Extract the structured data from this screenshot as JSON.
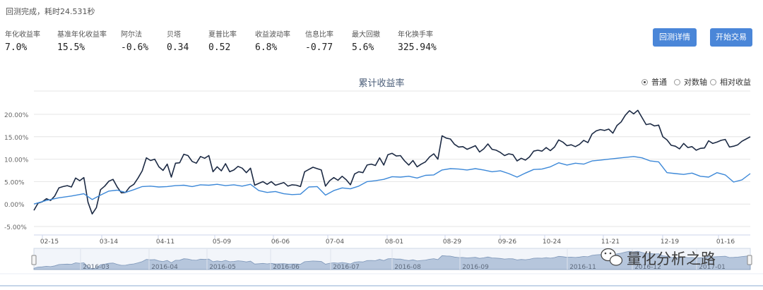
{
  "status": {
    "text": "回测完成，耗时24.531秒"
  },
  "metrics": [
    {
      "label": "年化收益率",
      "value": "7.0%"
    },
    {
      "label": "基准年化收益率",
      "value": "15.5%"
    },
    {
      "label": "阿尔法",
      "value": "-0.6%"
    },
    {
      "label": "贝塔",
      "value": "0.34"
    },
    {
      "label": "夏普比率",
      "value": "0.52"
    },
    {
      "label": "收益波动率",
      "value": "6.8%"
    },
    {
      "label": "信息比率",
      "value": "-0.77"
    },
    {
      "label": "最大回撤",
      "value": "5.6%"
    },
    {
      "label": "年化换手率",
      "value": "325.94%"
    }
  ],
  "buttons": {
    "details": "回测详情",
    "trade": "开始交易"
  },
  "chart_options": [
    {
      "label": "普通",
      "selected": true
    },
    {
      "label": "对数轴",
      "selected": false
    },
    {
      "label": "相对收益",
      "selected": false
    }
  ],
  "watermark": {
    "text": "量化分析之路"
  },
  "chart_data": {
    "type": "line",
    "title": "累计收益率",
    "y_ticks": [
      "20.00%",
      "15.00%",
      "10.00%",
      "5.00%",
      "0.00%",
      "-5.00%"
    ],
    "ylim": [
      -5,
      20
    ],
    "x_tick_labels": [
      "02-15",
      "03-14",
      "04-11",
      "05-09",
      "06-06",
      "07-04",
      "08-01",
      "08-29",
      "09-26",
      "10-24",
      "11-21",
      "12-19",
      "01-16"
    ],
    "navigator_labels": [
      "2016-03",
      "2016-04",
      "2016-05",
      "2016-06",
      "2016-07",
      "2016-08",
      "2016-09",
      "2016-11",
      "2016-12",
      "2017-01"
    ],
    "grid": true,
    "legend": "none",
    "colors": {
      "benchmark": "#1c2a44",
      "strategy": "#3c88d8"
    },
    "series": [
      {
        "key": "benchmark",
        "points": [
          [
            0,
            -1.4
          ],
          [
            1,
            0.2
          ],
          [
            2,
            0.5
          ],
          [
            3,
            1.2
          ],
          [
            4,
            0.8
          ],
          [
            5,
            1.8
          ],
          [
            6,
            3.6
          ],
          [
            7,
            3.9
          ],
          [
            8,
            4.1
          ],
          [
            9,
            3.8
          ],
          [
            10,
            5.8
          ],
          [
            11,
            5.2
          ],
          [
            12,
            5.9
          ],
          [
            13,
            0.4
          ],
          [
            14,
            -2.2
          ],
          [
            15,
            -0.8
          ],
          [
            16,
            3.2
          ],
          [
            17,
            4.0
          ],
          [
            18,
            5.1
          ],
          [
            19,
            5.5
          ],
          [
            20,
            3.8
          ],
          [
            21,
            2.5
          ],
          [
            22,
            2.6
          ],
          [
            23,
            3.8
          ],
          [
            24,
            4.4
          ],
          [
            25,
            5.8
          ],
          [
            26,
            7.4
          ],
          [
            27,
            10.3
          ],
          [
            28,
            9.7
          ],
          [
            29,
            10.0
          ],
          [
            30,
            8.3
          ],
          [
            31,
            7.5
          ],
          [
            32,
            8.9
          ],
          [
            33,
            6.0
          ],
          [
            34,
            9.1
          ],
          [
            35,
            9.2
          ],
          [
            36,
            11.1
          ],
          [
            37,
            10.8
          ],
          [
            38,
            9.5
          ],
          [
            39,
            9.1
          ],
          [
            40,
            10.6
          ],
          [
            41,
            10.2
          ],
          [
            42,
            10.8
          ],
          [
            43,
            7.2
          ],
          [
            44,
            8.3
          ],
          [
            45,
            7.4
          ],
          [
            46,
            9.0
          ],
          [
            47,
            7.2
          ],
          [
            48,
            7.6
          ],
          [
            49,
            8.4
          ],
          [
            50,
            8.0
          ],
          [
            51,
            7.0
          ],
          [
            52,
            8.0
          ],
          [
            53,
            4.2
          ],
          [
            54,
            4.6
          ],
          [
            55,
            5.0
          ],
          [
            56,
            4.4
          ],
          [
            57,
            5.0
          ],
          [
            58,
            4.2
          ],
          [
            59,
            4.5
          ],
          [
            60,
            4.8
          ],
          [
            61,
            4.0
          ],
          [
            62,
            4.3
          ],
          [
            63,
            4.2
          ],
          [
            64,
            3.9
          ],
          [
            65,
            7.2
          ],
          [
            66,
            7.7
          ],
          [
            67,
            8.2
          ],
          [
            68,
            7.9
          ],
          [
            69,
            7.6
          ],
          [
            70,
            4.0
          ],
          [
            71,
            5.2
          ],
          [
            72,
            5.9
          ],
          [
            73,
            5.3
          ],
          [
            74,
            6.2
          ],
          [
            75,
            5.4
          ],
          [
            76,
            4.3
          ],
          [
            77,
            6.7
          ],
          [
            78,
            7.2
          ],
          [
            79,
            7.0
          ],
          [
            80,
            8.7
          ],
          [
            81,
            8.9
          ],
          [
            82,
            8.6
          ],
          [
            83,
            10.3
          ],
          [
            84,
            8.7
          ],
          [
            85,
            11.0
          ],
          [
            86,
            11.3
          ],
          [
            87,
            10.7
          ],
          [
            88,
            10.8
          ],
          [
            89,
            9.6
          ],
          [
            90,
            8.7
          ],
          [
            91,
            9.7
          ],
          [
            92,
            8.3
          ],
          [
            93,
            8.9
          ],
          [
            94,
            9.4
          ],
          [
            95,
            10.5
          ],
          [
            96,
            11.2
          ],
          [
            97,
            10.0
          ],
          [
            98,
            15.2
          ],
          [
            99,
            14.7
          ],
          [
            100,
            14.5
          ],
          [
            101,
            13.3
          ],
          [
            102,
            12.7
          ],
          [
            103,
            12.8
          ],
          [
            104,
            12.2
          ],
          [
            105,
            12.6
          ],
          [
            106,
            13.0
          ],
          [
            107,
            11.6
          ],
          [
            108,
            12.3
          ],
          [
            109,
            13.4
          ],
          [
            110,
            12.2
          ],
          [
            111,
            12.0
          ],
          [
            112,
            11.5
          ],
          [
            113,
            10.8
          ],
          [
            114,
            11.2
          ],
          [
            115,
            11.0
          ],
          [
            116,
            9.6
          ],
          [
            117,
            10.2
          ],
          [
            118,
            9.8
          ],
          [
            119,
            10.5
          ],
          [
            120,
            11.8
          ],
          [
            121,
            12.0
          ],
          [
            122,
            11.8
          ],
          [
            123,
            12.6
          ],
          [
            124,
            11.9
          ],
          [
            125,
            12.7
          ],
          [
            126,
            14.3
          ],
          [
            127,
            13.8
          ],
          [
            128,
            13.0
          ],
          [
            129,
            13.2
          ],
          [
            130,
            12.8
          ],
          [
            131,
            13.3
          ],
          [
            132,
            14.2
          ],
          [
            133,
            13.7
          ],
          [
            134,
            15.6
          ],
          [
            135,
            16.3
          ],
          [
            136,
            16.6
          ],
          [
            137,
            16.4
          ],
          [
            138,
            16.7
          ],
          [
            139,
            15.8
          ],
          [
            140,
            17.5
          ],
          [
            141,
            18.3
          ],
          [
            142,
            19.8
          ],
          [
            143,
            20.8
          ],
          [
            144,
            20.1
          ],
          [
            145,
            20.9
          ],
          [
            146,
            19.3
          ],
          [
            147,
            17.7
          ],
          [
            148,
            17.9
          ],
          [
            149,
            17.4
          ],
          [
            150,
            17.6
          ],
          [
            151,
            15.0
          ],
          [
            152,
            14.3
          ],
          [
            153,
            13.1
          ],
          [
            154,
            12.9
          ],
          [
            155,
            12.3
          ],
          [
            156,
            13.5
          ],
          [
            157,
            12.6
          ],
          [
            158,
            12.8
          ],
          [
            159,
            12.0
          ],
          [
            160,
            12.4
          ],
          [
            161,
            12.5
          ],
          [
            162,
            14.1
          ],
          [
            163,
            13.5
          ],
          [
            164,
            13.8
          ],
          [
            165,
            14.2
          ],
          [
            166,
            14.4
          ],
          [
            167,
            12.7
          ],
          [
            168,
            12.9
          ],
          [
            169,
            13.2
          ],
          [
            170,
            14.0
          ],
          [
            171,
            14.5
          ],
          [
            172,
            15.0
          ]
        ]
      },
      {
        "key": "strategy",
        "points": [
          [
            0,
            0.0
          ],
          [
            3,
            0.8
          ],
          [
            6,
            1.4
          ],
          [
            9,
            1.8
          ],
          [
            12,
            2.3
          ],
          [
            14,
            1.0
          ],
          [
            16,
            2.0
          ],
          [
            18,
            2.9
          ],
          [
            20,
            3.1
          ],
          [
            22,
            2.6
          ],
          [
            24,
            3.2
          ],
          [
            26,
            3.9
          ],
          [
            28,
            4.0
          ],
          [
            30,
            3.8
          ],
          [
            32,
            3.9
          ],
          [
            34,
            4.1
          ],
          [
            36,
            4.2
          ],
          [
            38,
            3.9
          ],
          [
            40,
            4.3
          ],
          [
            42,
            4.2
          ],
          [
            44,
            4.4
          ],
          [
            46,
            4.1
          ],
          [
            48,
            4.3
          ],
          [
            50,
            4.0
          ],
          [
            52,
            4.4
          ],
          [
            54,
            3.0
          ],
          [
            56,
            2.6
          ],
          [
            58,
            2.8
          ],
          [
            60,
            2.3
          ],
          [
            62,
            2.1
          ],
          [
            64,
            2.2
          ],
          [
            66,
            3.8
          ],
          [
            68,
            3.9
          ],
          [
            70,
            2.0
          ],
          [
            72,
            3.0
          ],
          [
            74,
            3.6
          ],
          [
            76,
            3.4
          ],
          [
            78,
            4.0
          ],
          [
            80,
            5.0
          ],
          [
            82,
            5.2
          ],
          [
            84,
            5.5
          ],
          [
            86,
            6.1
          ],
          [
            88,
            6.0
          ],
          [
            90,
            6.2
          ],
          [
            92,
            5.8
          ],
          [
            94,
            6.4
          ],
          [
            96,
            6.5
          ],
          [
            98,
            7.6
          ],
          [
            100,
            7.9
          ],
          [
            102,
            7.8
          ],
          [
            104,
            7.6
          ],
          [
            106,
            7.9
          ],
          [
            108,
            7.6
          ],
          [
            110,
            7.2
          ],
          [
            112,
            7.4
          ],
          [
            114,
            6.8
          ],
          [
            116,
            6.0
          ],
          [
            118,
            6.9
          ],
          [
            120,
            7.7
          ],
          [
            122,
            7.8
          ],
          [
            124,
            8.3
          ],
          [
            126,
            9.2
          ],
          [
            128,
            8.7
          ],
          [
            130,
            9.1
          ],
          [
            132,
            8.9
          ],
          [
            134,
            9.6
          ],
          [
            136,
            9.8
          ],
          [
            138,
            10.0
          ],
          [
            140,
            10.2
          ],
          [
            142,
            10.4
          ],
          [
            144,
            10.6
          ],
          [
            146,
            10.3
          ],
          [
            148,
            9.6
          ],
          [
            150,
            9.4
          ],
          [
            152,
            7.0
          ],
          [
            154,
            6.8
          ],
          [
            156,
            6.6
          ],
          [
            158,
            6.9
          ],
          [
            160,
            6.2
          ],
          [
            162,
            6.0
          ],
          [
            164,
            7.0
          ],
          [
            166,
            6.5
          ],
          [
            168,
            4.9
          ],
          [
            170,
            5.4
          ],
          [
            172,
            6.8
          ]
        ]
      }
    ]
  }
}
